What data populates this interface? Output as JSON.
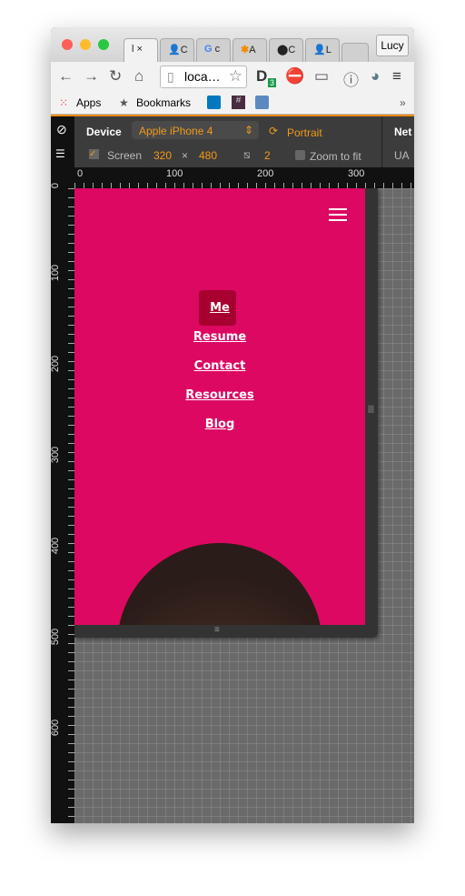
{
  "browser": {
    "tabs": [
      {
        "label": "l",
        "active": true
      },
      {
        "label": "C"
      },
      {
        "label": "c"
      },
      {
        "label": "A"
      },
      {
        "label": "C"
      },
      {
        "label": "L"
      }
    ],
    "profile": "Lucy",
    "address": "loca…",
    "extension_badge": "3",
    "bookmarks": {
      "apps": "Apps",
      "bookmarks": "Bookmarks",
      "overflow": "»"
    }
  },
  "devtools": {
    "device_label": "Device",
    "device": "Apple iPhone 4",
    "orientation": "Portrait",
    "screen_label": "Screen",
    "width": "320",
    "times": "×",
    "height": "480",
    "dpr": "2",
    "zoom_to_fit": "Zoom to fit",
    "network": "Net",
    "ua": "UA",
    "ruler_x": [
      "0",
      "100",
      "200",
      "300"
    ],
    "ruler_y": [
      "0",
      "100",
      "200",
      "300",
      "400",
      "500",
      "600"
    ]
  },
  "page": {
    "background": "#dc0862",
    "nav": [
      "Me",
      "Resume",
      "Contact",
      "Resources",
      "Blog"
    ],
    "active": "Me"
  }
}
